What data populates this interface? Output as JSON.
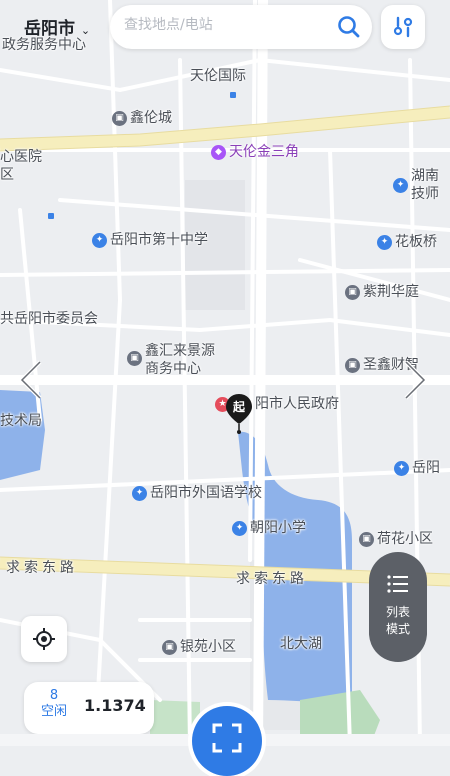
{
  "top_bar": {
    "city": "岳阳市",
    "search_placeholder": "查找地点/电站"
  },
  "map": {
    "labels": {
      "civic_center": "政务服务中心",
      "tianlun": "天伦国际",
      "xinlun": "鑫伦城",
      "hospital": "心医院",
      "district": "区",
      "tianlun_sanjiao": "天伦金三角",
      "hunan_tech_1": "湖南",
      "hunan_tech_2": "技师",
      "school10": "岳阳市第十中学",
      "huaban": "花板桥",
      "zijing": "紫荆华庭",
      "committee": "共岳阳市委员会",
      "xinhui_1": "鑫汇来景源",
      "xinhui_2": "商务中心",
      "shengxin": "圣鑫财智",
      "jingshu": "技术局",
      "gov": "阳市人民政府",
      "yueyang_r": "岳阳",
      "foreign_school": "岳阳市外国语学校",
      "chaoyang": "朝阳小学",
      "hehua": "荷花小区",
      "road_left": "求索东路",
      "road_right": "求索东路",
      "yinyuan": "银苑小区",
      "beidahu": "北大湖"
    },
    "start_marker": "起"
  },
  "list_mode": {
    "line1": "列表",
    "line2": "模式"
  },
  "stats": {
    "count": "8",
    "count_label": "空闲",
    "value": "1.1374"
  },
  "colors": {
    "accent": "#2f7be5",
    "water": "#8eb2ea",
    "road": "#f3e7a9"
  }
}
